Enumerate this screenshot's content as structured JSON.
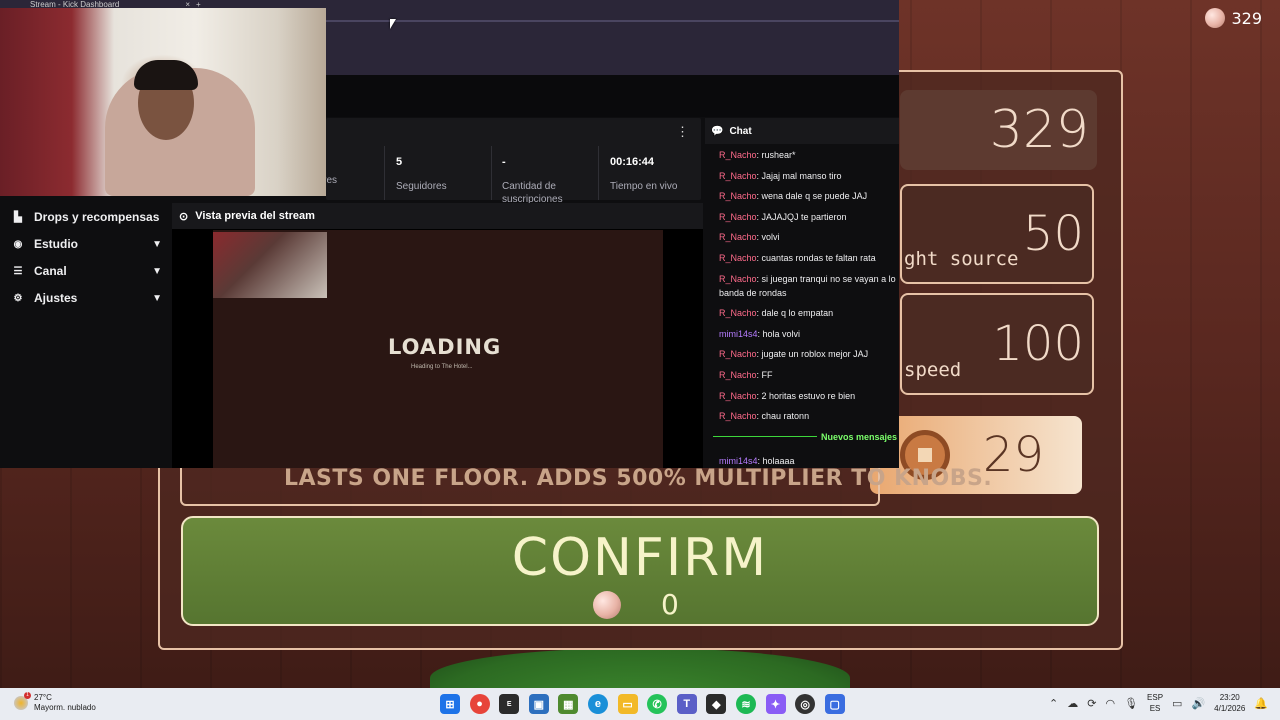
{
  "game": {
    "robux_balance": "329",
    "stat_values": [
      "329",
      "50",
      "100"
    ],
    "stat_labels": [
      "ght source",
      "speed"
    ],
    "robux_price": "29",
    "item_description": "LASTS ONE FLOOR. ADDS 500% MULTIPLIER TO KNOBS.",
    "confirm_label": "CONFIRM",
    "confirm_cost": "0"
  },
  "browser": {
    "tab_title": "Stream - Kick Dashboard",
    "tab_close": "×",
    "tab_new": "+"
  },
  "dashboard": {
    "more_icon": "⋮",
    "stats": [
      {
        "value": "",
        "label": "dores"
      },
      {
        "value": "5",
        "label": "Seguidores"
      },
      {
        "value": "-",
        "label": "Cantidad de suscripciones"
      },
      {
        "value": "00:16:44",
        "label": "Tiempo en vivo"
      }
    ],
    "sidebar": [
      {
        "label": "Drops y recompensas",
        "icon": "drops-icon"
      },
      {
        "label": "Estudio",
        "icon": "studio-icon"
      },
      {
        "label": "Canal",
        "icon": "channel-icon"
      },
      {
        "label": "Ajustes",
        "icon": "settings-icon"
      }
    ],
    "preview_title": "Vista previa del stream",
    "preview_loading": "LOADING",
    "preview_loading_sub": "Heading to The Hotel..."
  },
  "chat": {
    "title": "Chat",
    "messages": [
      {
        "user": "R_Nacho",
        "text": ": rushear*"
      },
      {
        "user": "R_Nacho",
        "text": ": Jajaj mal manso tiro"
      },
      {
        "user": "R_Nacho",
        "text": ": wena dale q se puede JAJ"
      },
      {
        "user": "R_Nacho",
        "text": ": JAJAJQJ te partieron"
      },
      {
        "user": "R_Nacho",
        "text": ": volvi"
      },
      {
        "user": "R_Nacho",
        "text": ": cuantas rondas te faltan rata"
      },
      {
        "user": "R_Nacho",
        "text": ": si juegan tranqui no se vayan a lo banda de rondas"
      },
      {
        "user": "R_Nacho",
        "text": ": dale q lo empatan"
      },
      {
        "user": "mimi14s4",
        "text": ": hola volvi"
      },
      {
        "user": "R_Nacho",
        "text": ": jugate un roblox mejor JAJ"
      },
      {
        "user": "R_Nacho",
        "text": ": FF"
      },
      {
        "user": "R_Nacho",
        "text": ": 2 horitas estuvo re bien"
      },
      {
        "user": "R_Nacho",
        "text": ": chau ratonn"
      }
    ],
    "new_messages_label": "Nuevos mensajes",
    "after_new": {
      "user": "mimi14s4",
      "text": ": holaaaa"
    }
  },
  "taskbar": {
    "temperature": "27°C",
    "weather": "Mayorm. nublado",
    "lang_top": "ESP",
    "lang_bottom": "ES",
    "time": "23:20",
    "date": "4/1/2026"
  },
  "colors": {
    "chat_user_pink": "#ff6b8b",
    "chat_user_purple": "#b57cff",
    "new_messages_green": "#7bff6b",
    "confirm_green": "#6b8a3c"
  }
}
